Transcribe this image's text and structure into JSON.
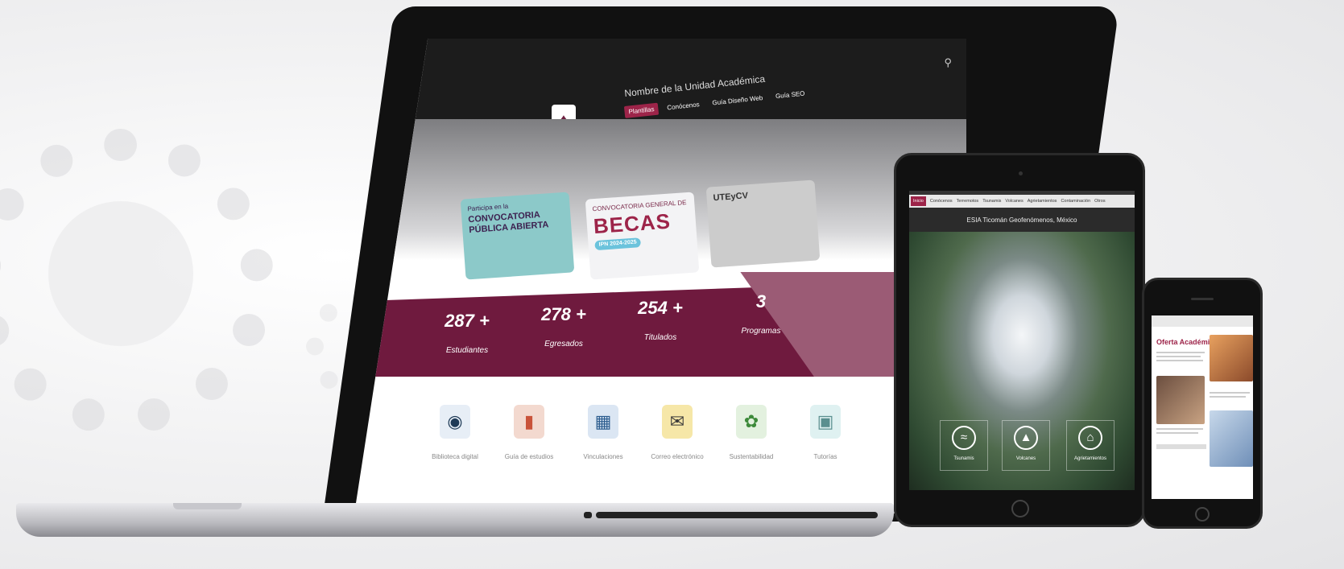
{
  "colors": {
    "primary": "#6f1a3e",
    "accent": "#9d2449",
    "stats_secondary": "#9b5b75"
  },
  "laptop": {
    "unit_name": "Nombre de la Unidad Académica",
    "nav": [
      {
        "label": "Plantillas",
        "active": true
      },
      {
        "label": "Conócenos",
        "active": false
      },
      {
        "label": "Guía Diseño Web",
        "active": false
      },
      {
        "label": "Guía SEO",
        "active": false
      }
    ],
    "cards": [
      {
        "small": "Participa en la",
        "title": "CONVOCATORIA PÚBLICA ABIERTA"
      },
      {
        "small": "CONVOCATORIA GENERAL DE",
        "title": "BECAS",
        "badge": "IPN 2024-2025"
      },
      {
        "title": "UTEyCV"
      }
    ],
    "stats": [
      {
        "number": "287 +",
        "label": "Estudiantes"
      },
      {
        "number": "278 +",
        "label": "Egresados"
      },
      {
        "number": "254 +",
        "label": "Titulados"
      },
      {
        "number": "3",
        "label": "Programas"
      }
    ],
    "quick_links": [
      {
        "label": "Biblioteca digital",
        "icon": "library-icon"
      },
      {
        "label": "Guía de estudios",
        "icon": "tablet-icon"
      },
      {
        "label": "Vinculaciones",
        "icon": "network-icon"
      },
      {
        "label": "Correo electrónico",
        "icon": "mail-icon"
      },
      {
        "label": "Sustentabilidad",
        "icon": "plant-hand-icon"
      },
      {
        "label": "Tutorías",
        "icon": "tutoring-icon"
      }
    ]
  },
  "tablet": {
    "nav": [
      {
        "label": "Inicio",
        "active": true
      },
      {
        "label": "Conócenos",
        "active": false
      },
      {
        "label": "Terremotos",
        "active": false
      },
      {
        "label": "Tsunamis",
        "active": false
      },
      {
        "label": "Volcanes",
        "active": false
      },
      {
        "label": "Agrietamientos",
        "active": false
      },
      {
        "label": "Contaminación",
        "active": false
      },
      {
        "label": "Otros",
        "active": false
      }
    ],
    "title": "ESIA Ticomán Geofenómenos, México",
    "tiles": [
      {
        "label": "Tsunamis",
        "icon": "wave-icon"
      },
      {
        "label": "Volcanes",
        "icon": "volcano-icon"
      },
      {
        "label": "Agrietamientos",
        "icon": "crack-icon"
      }
    ]
  },
  "phone": {
    "title": "Oferta Académica"
  }
}
